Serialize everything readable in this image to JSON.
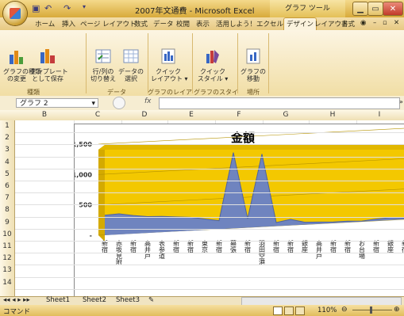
{
  "title_bar": {
    "window_title": "2007年文通費 - Microsoft Excel",
    "tool_title": "グラフ ツール",
    "qat_icons": [
      "save-icon",
      "undo-icon",
      "redo-icon"
    ]
  },
  "tabs": [
    "ホーム",
    "挿入",
    "ページ レイアウト",
    "数式",
    "データ",
    "校閲",
    "表示",
    "活用しよう！エクセル",
    "デザイン",
    "レイアウト",
    "書式"
  ],
  "active_tab": "デザイン",
  "ribbon": {
    "buttons": [
      {
        "name": "change-chart-type-button",
        "label": "グラフの種類\nの変更",
        "icon": "chart-type-icon"
      },
      {
        "name": "save-template-button",
        "label": "テンプレート\nとして保存",
        "icon": "template-icon"
      },
      {
        "name": "switch-row-col-button",
        "label": "行/列の\n切り替え",
        "icon": "switch-icon"
      },
      {
        "name": "select-data-button",
        "label": "データの\n選択",
        "icon": "select-data-icon"
      },
      {
        "name": "quick-layout-button",
        "label": "クイック\nレイアウト ▾",
        "icon": "layout-icon"
      },
      {
        "name": "quick-style-button",
        "label": "クイック\nスタイル ▾",
        "icon": "style-icon"
      },
      {
        "name": "move-chart-button",
        "label": "グラフの\n移動",
        "icon": "move-chart-icon"
      }
    ],
    "groups": [
      "種類",
      "データ",
      "グラフのレイアウト",
      "グラフのスタイル",
      "場所"
    ]
  },
  "formula_bar": {
    "name_box": "グラフ 2",
    "fx": "fx",
    "value": ""
  },
  "columns": [
    "B",
    "C",
    "D",
    "E",
    "F",
    "G",
    "H",
    "I"
  ],
  "rows": [
    "1",
    "2",
    "3",
    "4",
    "5",
    "6",
    "7",
    "8",
    "9",
    "10",
    "11",
    "12",
    "13",
    "14"
  ],
  "chart_data": {
    "type": "area",
    "title": "金額",
    "y_ticks": [
      "1,500",
      "1,000",
      "500",
      "-"
    ],
    "ylim": [
      0,
      1500
    ],
    "categories": [
      "新宿",
      "赤坂見附",
      "新宿",
      "高井戸",
      "表参道",
      "新宿",
      "新宿",
      "東京",
      "新宿",
      "幕張",
      "新宿",
      "羽田空港",
      "新宿",
      "新宿",
      "銀座",
      "高井戸",
      "新宿",
      "新宿",
      "お台場",
      "新宿",
      "銀座",
      "新宿"
    ],
    "values": [
      330,
      340,
      300,
      270,
      260,
      240,
      220,
      180,
      140,
      1250,
      150,
      1200,
      60,
      100,
      40,
      30,
      20,
      20,
      10,
      30,
      40,
      20
    ],
    "colors": {
      "area": "#6f84bf",
      "back_wall": "#f3c800",
      "side_wall": "#d4aa00"
    }
  },
  "sheet_tabs": [
    "Sheet1",
    "Sheet2",
    "Sheet3"
  ],
  "status": {
    "mode": "コマンド",
    "zoom": "110%"
  }
}
